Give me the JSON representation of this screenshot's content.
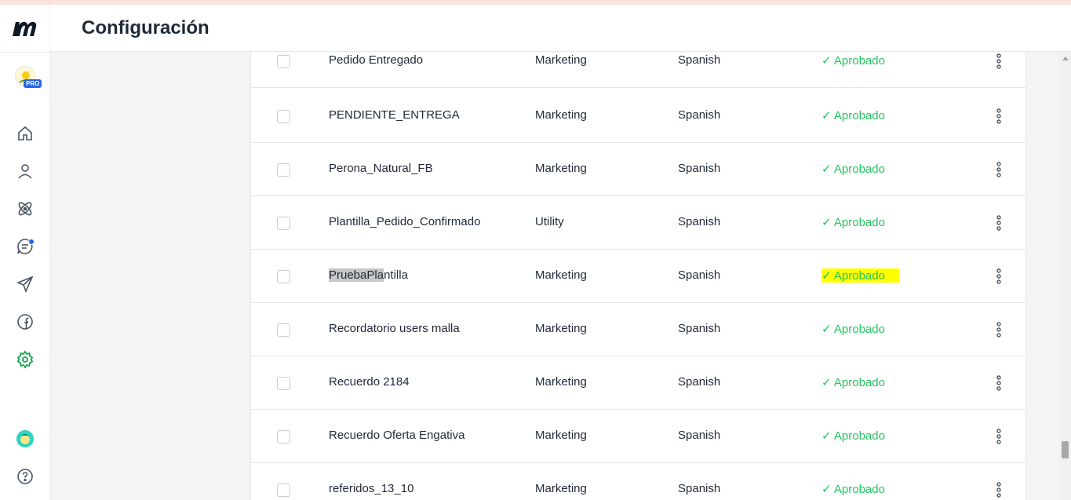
{
  "header": {
    "title": "Configuración"
  },
  "sidebar": {
    "logo": "m",
    "pro_badge": "PRO",
    "icons": [
      "home-icon",
      "user-icon",
      "atom-icon",
      "chat-icon",
      "send-icon",
      "facebook-icon",
      "settings-icon",
      "user-avatar-icon",
      "help-icon"
    ],
    "active_color": "#16a34a"
  },
  "table": {
    "rows": [
      {
        "name": "Pedido Entregado",
        "category": "Marketing",
        "language": "Spanish",
        "status": "✓ Aprobado"
      },
      {
        "name": "PENDIENTE_ENTREGA",
        "category": "Marketing",
        "language": "Spanish",
        "status": "✓ Aprobado"
      },
      {
        "name": "Perona_Natural_FB",
        "category": "Marketing",
        "language": "Spanish",
        "status": "✓ Aprobado"
      },
      {
        "name": "Plantilla_Pedido_Confirmado",
        "category": "Utility",
        "language": "Spanish",
        "status": "✓ Aprobado"
      },
      {
        "name_a": "PruebaPla",
        "name_b": "ntilla",
        "category": "Marketing",
        "language": "Spanish",
        "status": "✓ Aprobado"
      },
      {
        "name": "Recordatorio users malla",
        "category": "Marketing",
        "language": "Spanish",
        "status": "✓ Aprobado"
      },
      {
        "name": "Recuerdo 2184",
        "category": "Marketing",
        "language": "Spanish",
        "status": "✓ Aprobado"
      },
      {
        "name": "Recuerdo Oferta Engativa",
        "category": "Marketing",
        "language": "Spanish",
        "status": "✓ Aprobado"
      },
      {
        "name": "referidos_13_10",
        "category": "Marketing",
        "language": "Spanish",
        "status": "✓ Aprobado"
      }
    ]
  },
  "colors": {
    "approved": "#22c55e",
    "highlight": "#ffff00"
  }
}
